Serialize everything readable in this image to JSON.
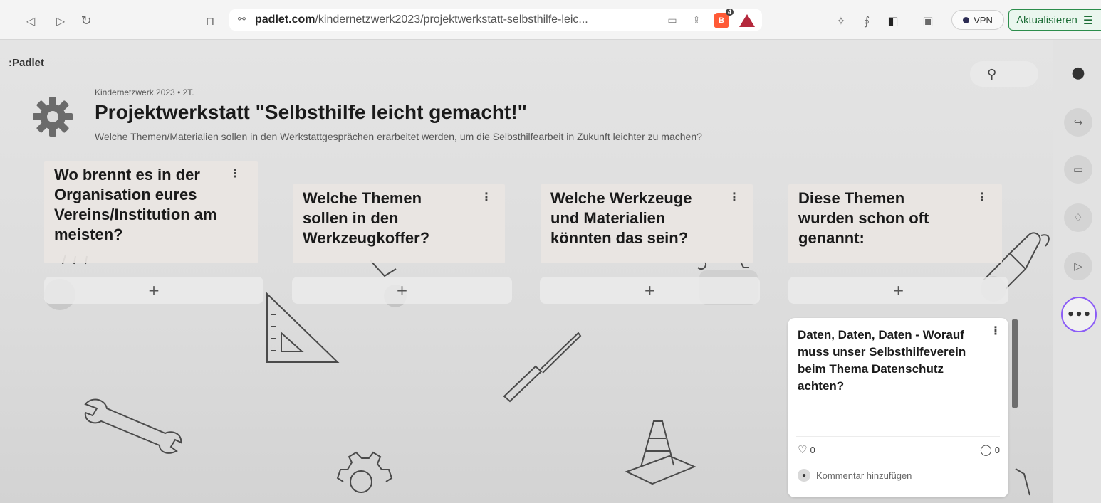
{
  "browser": {
    "url_domain": "padlet.com",
    "url_path": "/kindernetzwerk2023/projektwerkstatt-selbsthilfe-leic...",
    "brave_badge": "4",
    "vpn_label": "VPN",
    "update_label": "Aktualisieren",
    "icons": [
      "back-icon",
      "forward-icon",
      "reload-icon",
      "bookmark-icon",
      "site-settings-icon",
      "cast-icon",
      "share-icon",
      "brave-shields-icon",
      "brave-rewards-icon",
      "extensions-icon",
      "leo-icon",
      "sidebar-icon",
      "wallet-icon",
      "menu-icon"
    ]
  },
  "padlet": {
    "brand": ":Padlet",
    "meta_author": "Kindernetzwerk.2023",
    "meta_time": "2T.",
    "title": "Projektwerkstatt \"Selbsthilfe leicht gemacht!\"",
    "subtitle": "Welche Themen/Materialien sollen in den Werkstattgesprächen erarbeitet werden, um die Selbsthilfearbeit in Zukunft leichter zu machen?",
    "columns": [
      {
        "title": "Wo brennt es in der Organisation eures Vereins/Institution am meisten?"
      },
      {
        "title": "Welche Themen sollen in den Werkzeugkoffer?"
      },
      {
        "title": "Welche Werkzeuge und Materialien könnten das sein?"
      },
      {
        "title": "Diese Themen wurden schon oft genannt:"
      }
    ],
    "add_label": "+",
    "post": {
      "title": "Daten, Daten, Daten - Worauf muss unser Selbsthilfeverein beim Thema Datenschutz achten?",
      "likes": "0",
      "comments": "0",
      "add_comment": "Kommentar hinzufügen"
    }
  }
}
